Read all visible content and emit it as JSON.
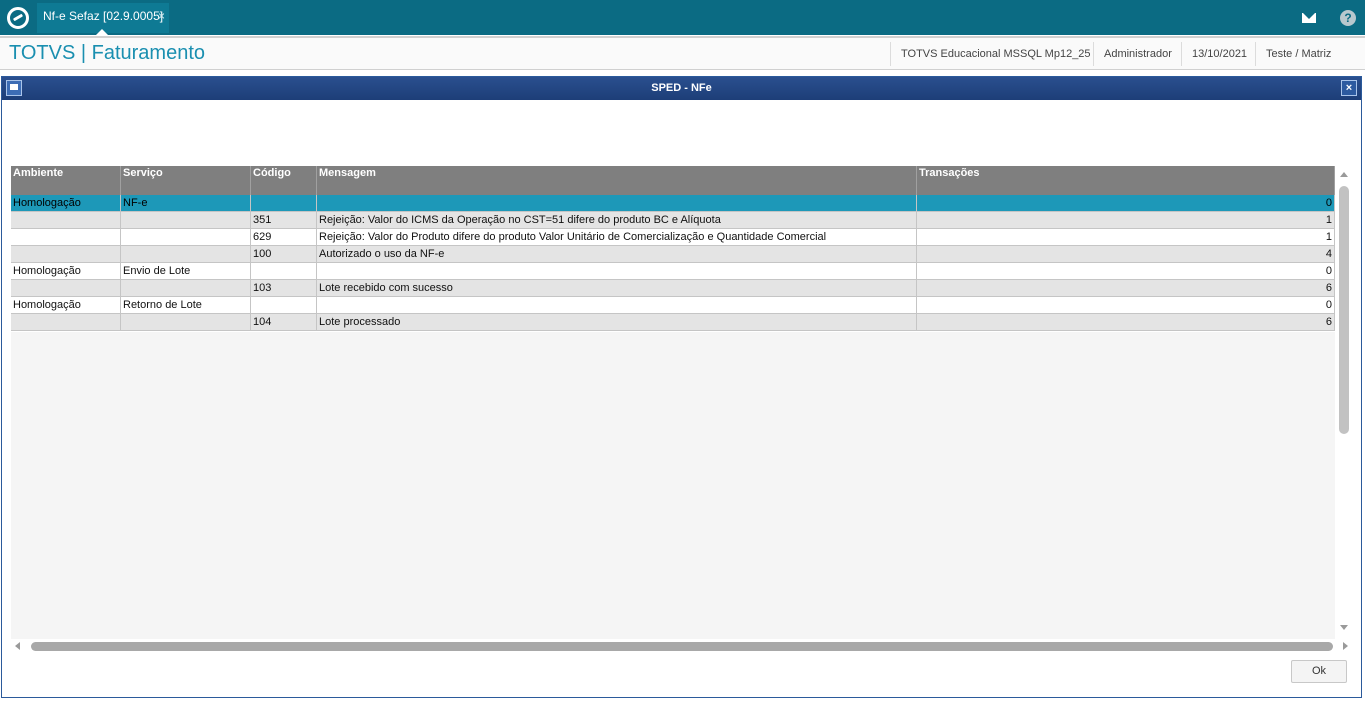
{
  "topbar": {
    "tab_label": "Nf-e Sefaz [02.9.0005]",
    "tab_close": "×",
    "help_glyph": "?"
  },
  "header": {
    "app_title": "TOTVS | Faturamento",
    "environment": "TOTVS Educacional MSSQL Mp12_25",
    "user": "Administrador",
    "date": "13/10/2021",
    "company": "Teste / Matriz"
  },
  "dialog": {
    "title": "SPED - NFe",
    "close_glyph": "×",
    "ok_label": "Ok"
  },
  "grid": {
    "columns": [
      "Ambiente",
      "Serviço",
      "Código",
      "Mensagem",
      "Transações"
    ],
    "rows": [
      {
        "ambiente": "Homologação",
        "servico": "NF-e",
        "codigo": "",
        "mensagem": "",
        "transacoes": "0"
      },
      {
        "ambiente": "",
        "servico": "",
        "codigo": "351",
        "mensagem": "Rejeição: Valor do ICMS da Operação no CST=51 difere do produto BC e Alíquota",
        "transacoes": "1"
      },
      {
        "ambiente": "",
        "servico": "",
        "codigo": "629",
        "mensagem": "Rejeição: Valor do Produto difere do produto Valor Unitário de Comercialização e Quantidade Comercial",
        "transacoes": "1"
      },
      {
        "ambiente": "",
        "servico": "",
        "codigo": "100",
        "mensagem": "Autorizado o uso da NF-e",
        "transacoes": "4"
      },
      {
        "ambiente": "Homologação",
        "servico": "Envio de Lote",
        "codigo": "",
        "mensagem": "",
        "transacoes": "0"
      },
      {
        "ambiente": "",
        "servico": "",
        "codigo": "103",
        "mensagem": "Lote recebido com sucesso",
        "transacoes": "6"
      },
      {
        "ambiente": "Homologação",
        "servico": "Retorno de Lote",
        "codigo": "",
        "mensagem": "",
        "transacoes": "0"
      },
      {
        "ambiente": "",
        "servico": "",
        "codigo": "104",
        "mensagem": "Lote processado",
        "transacoes": "6"
      }
    ]
  },
  "colors": {
    "topbar": "#0b6b83",
    "title_accent": "#1a8fb0",
    "selected_row": "#1d98b8",
    "dialog_title": "#2a4f8f"
  }
}
